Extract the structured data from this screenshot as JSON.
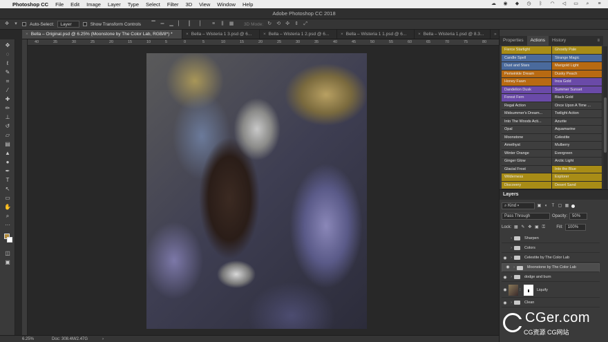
{
  "menubar": {
    "app_name": "Photoshop CC",
    "items": [
      "File",
      "Edit",
      "Image",
      "Layer",
      "Type",
      "Select",
      "Filter",
      "3D",
      "View",
      "Window",
      "Help"
    ]
  },
  "window": {
    "title": "Adobe Photoshop CC 2018"
  },
  "options": {
    "auto_select_label": "Auto-Select:",
    "auto_select_value": "Layer",
    "transform_label": "Show Transform Controls",
    "mode_3d_label": "3D Mode:"
  },
  "tabs": [
    "Bella – Original.psd @ 6.25% (Moonstone by The Color Lab, RGB/8*) *",
    "Bella – Wisteria 1 3.psd @ 6...",
    "Bella – Wisteria 1 2.psd @ 6...",
    "Bella – Wisteria 1 1.psd @ 6...",
    "Bella – Wisteria 1.psd @ 8.3..."
  ],
  "ruler_labels": [
    "40",
    "35",
    "30",
    "25",
    "20",
    "15",
    "10",
    "5",
    "0",
    "5",
    "10",
    "15",
    "20",
    "25",
    "30",
    "35",
    "40",
    "45",
    "50",
    "55",
    "60",
    "65",
    "70",
    "75",
    "80"
  ],
  "status": {
    "zoom": "6.25%",
    "doc": "Doc: 308.4M/2.47G"
  },
  "panel": {
    "tabs": [
      "Properties",
      "Actions",
      "History"
    ],
    "actions": [
      [
        {
          "label": "Fierce Starlight",
          "color": "#a88c16"
        },
        {
          "label": "Ghostly Pale",
          "color": "#a88c16"
        }
      ],
      [
        {
          "label": "Candle Spell",
          "color": "#4a6a9c"
        },
        {
          "label": "Strange Magic",
          "color": "#4a6a9c"
        }
      ],
      [
        {
          "label": "Dust and Stars",
          "color": "#4a6a9c"
        },
        {
          "label": "Marigold Light",
          "color": "#b86a12"
        }
      ],
      [
        {
          "label": "Periwinkle Dream",
          "color": "#b86a12"
        },
        {
          "label": "Dusky Peach",
          "color": "#b86a12"
        }
      ],
      [
        {
          "label": "Honey Fawn",
          "color": "#b86a12"
        },
        {
          "label": "Inca Gold",
          "color": "#6a4aa8"
        }
      ],
      [
        {
          "label": "Dandelion Dusk",
          "color": "#6a4aa8"
        },
        {
          "label": "Summer Sunset",
          "color": "#6a4aa8"
        }
      ],
      [
        {
          "label": "Forest Fern",
          "color": "#6a4aa8"
        },
        {
          "label": "Black Gold",
          "color": "#3e3e3e"
        }
      ],
      [
        {
          "label": "Regal Action",
          "color": "#3e3e3e"
        },
        {
          "label": "Once Upon A Time ...",
          "color": "#3e3e3e"
        }
      ],
      [
        {
          "label": "Midsummer's Dream...",
          "color": "#3e3e3e"
        },
        {
          "label": "Twilight Action",
          "color": "#3e3e3e"
        }
      ],
      [
        {
          "label": "Into The Woods Acti...",
          "color": "#3e3e3e"
        },
        {
          "label": "Azurite",
          "color": "#3e3e3e"
        }
      ],
      [
        {
          "label": "Opal",
          "color": "#3e3e3e"
        },
        {
          "label": "Aquamarine",
          "color": "#3e3e3e"
        }
      ],
      [
        {
          "label": "Moonstone",
          "color": "#3e3e3e"
        },
        {
          "label": "Celestite",
          "color": "#3e3e3e"
        }
      ],
      [
        {
          "label": "Amethyst",
          "color": "#3e3e3e"
        },
        {
          "label": "Mulberry",
          "color": "#3e3e3e"
        }
      ],
      [
        {
          "label": "Winter Orange",
          "color": "#3e3e3e"
        },
        {
          "label": "Evergreen",
          "color": "#3e3e3e"
        }
      ],
      [
        {
          "label": "Ginger Glow",
          "color": "#3e3e3e"
        },
        {
          "label": "Arctic Light",
          "color": "#3e3e3e"
        }
      ],
      [
        {
          "label": "Glacial Frost",
          "color": "#3e3e3e"
        },
        {
          "label": "Into the Blue",
          "color": "#a88c16"
        }
      ],
      [
        {
          "label": "Wilderness",
          "color": "#a88c16"
        },
        {
          "label": "Explorer",
          "color": "#a88c16"
        }
      ],
      [
        {
          "label": "Discovery",
          "color": "#a88c16"
        },
        {
          "label": "Desert Sand",
          "color": "#a88c16"
        }
      ]
    ]
  },
  "layers": {
    "title": "Layers",
    "kind_label": "Kind",
    "blend_mode": "Pass Through",
    "opacity_label": "Opacity:",
    "opacity_value": "50%",
    "lock_label": "Lock:",
    "fill_label": "Fill:",
    "fill_value": "100%",
    "items": [
      "Sharpen",
      "Colors",
      "Celestite by The Color Lab",
      "Moonstone by The Color Lab",
      "dodge and burn",
      "Liquify",
      "Clean"
    ]
  },
  "watermark": {
    "main": "CGer.com",
    "sub": "CG资源 CG网站"
  }
}
